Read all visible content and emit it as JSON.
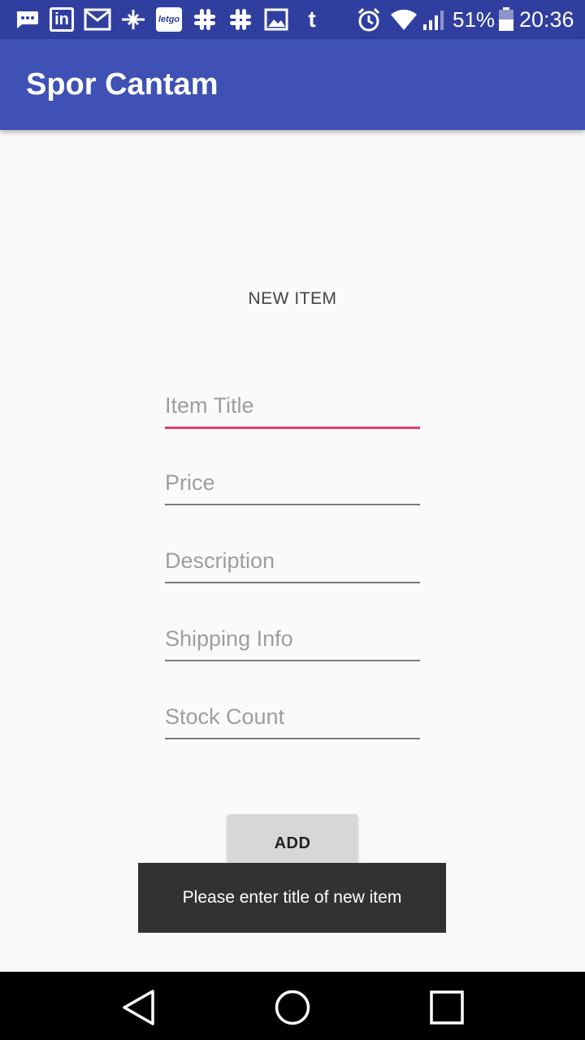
{
  "status_bar": {
    "left_icons": [
      "messages-icon",
      "linkedin-icon",
      "gmail-icon",
      "plane-icon",
      "letgo-icon",
      "slack-icon",
      "slack-icon",
      "image-icon",
      "tumblr-icon"
    ],
    "letgo_text": "letgo",
    "linkedin_text": "in",
    "tumblr_text": "t",
    "battery_percent": "51%",
    "time": "20:36"
  },
  "app_bar": {
    "title": "Spor Cantam"
  },
  "form": {
    "heading": "NEW ITEM",
    "fields": [
      {
        "placeholder": "Item Title",
        "value": ""
      },
      {
        "placeholder": "Price",
        "value": ""
      },
      {
        "placeholder": "Description",
        "value": ""
      },
      {
        "placeholder": "Shipping Info",
        "value": ""
      },
      {
        "placeholder": "Stock Count",
        "value": ""
      }
    ],
    "add_label": "ADD"
  },
  "toast": {
    "message": "Please enter title of new item"
  },
  "colors": {
    "primary": "#3f51b5",
    "primary_dark": "#303f9f",
    "accent": "#e0406c"
  }
}
